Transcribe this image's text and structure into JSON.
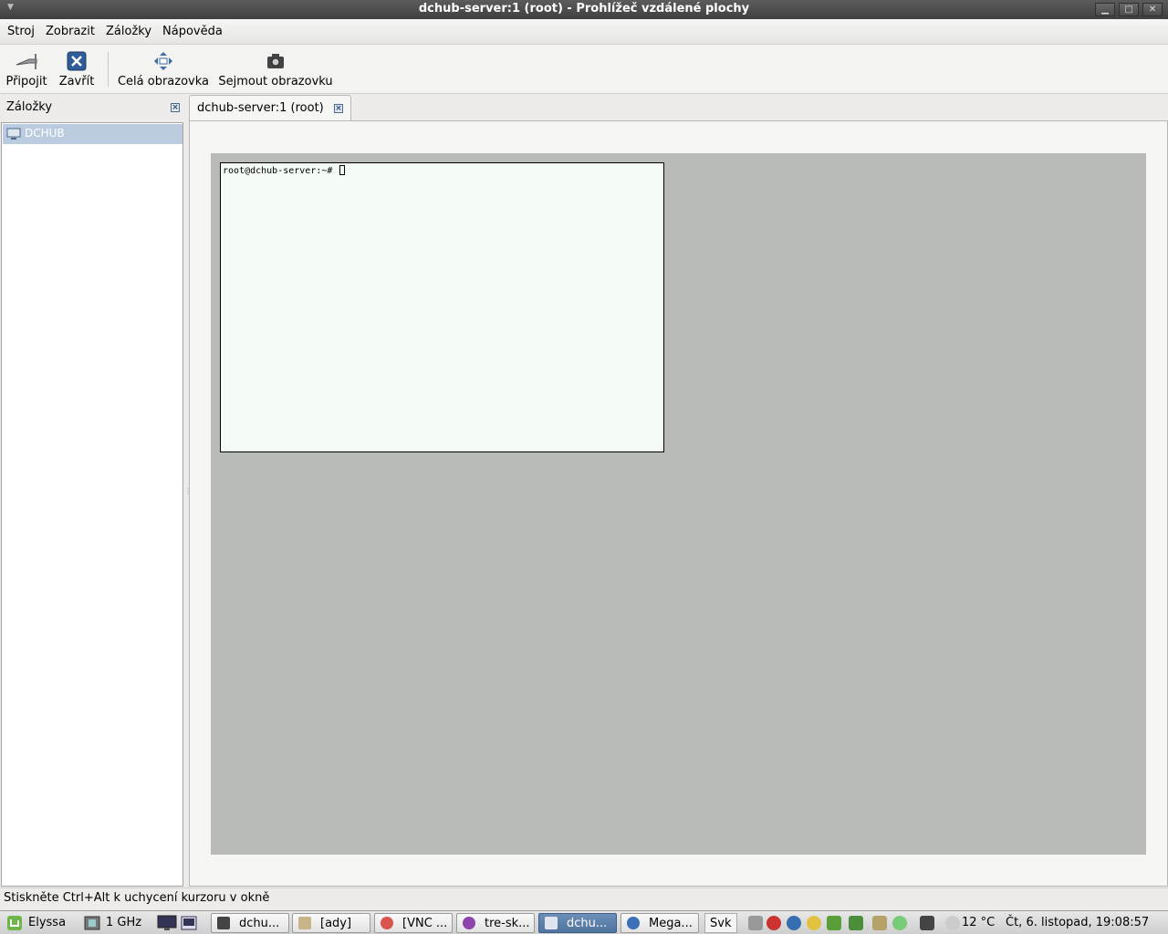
{
  "window": {
    "title": "dchub-server:1 (root) - Prohlížeč vzdálené plochy"
  },
  "menu": [
    "Stroj",
    "Zobrazit",
    "Záložky",
    "Nápověda"
  ],
  "toolbar": {
    "connect": "Připojit",
    "close": "Zavřít",
    "fullscreen": "Celá obrazovka",
    "screenshot": "Sejmout obrazovku"
  },
  "sidebar": {
    "title": "Záložky",
    "items": [
      "DCHUB"
    ]
  },
  "tabs": [
    {
      "label": "dchub-server:1 (root)"
    }
  ],
  "remote": {
    "prompt": "root@dchub-server:~#"
  },
  "status": "Stiskněte Ctrl+Alt k uchycení kurzoru v okně",
  "taskbar": {
    "start": "Elyssa",
    "cpu": "1 GHz",
    "tasks": [
      "dchu...",
      "[ady]",
      "[VNC ...",
      "tre-sk...",
      "dchu...",
      "Mega..."
    ],
    "layout": "Svk",
    "temperature": "12 °C",
    "clock": "Čt,  6. listopad, 19:08:57"
  },
  "colors": {
    "remote_bg": "#b8bbb6",
    "selection": "#bccce0",
    "active_task": "#4f749f"
  }
}
